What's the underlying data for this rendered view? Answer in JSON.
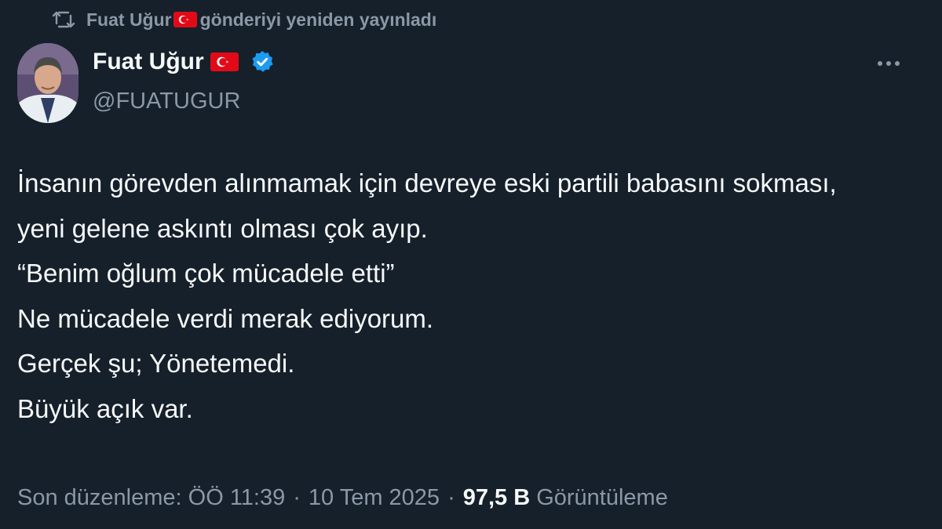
{
  "repost": {
    "name": "Fuat Uğur",
    "flag_icon": "turkey-flag-icon",
    "text": "gönderiyi yeniden yayınladı"
  },
  "author": {
    "display_name": "Fuat Uğur",
    "handle": "@FUATUGUR",
    "verified": true,
    "verified_color": "#1d9bf0"
  },
  "tweet": {
    "lines": [
      "İnsanın görevden alınmamak için devreye eski partili babasını sokması,",
      "yeni gelene askıntı olması çok ayıp.",
      "“Benim oğlum çok mücadele etti”",
      "Ne mücadele verdi merak ediyorum.",
      "Gerçek şu; Yönetemedi.",
      "Büyük açık var."
    ]
  },
  "meta": {
    "edited_label": "Son düzenleme: ÖÖ 11:39",
    "separator": "·",
    "date": "10 Tem 2025",
    "views_count": "97,5 B",
    "views_label": "Görüntüleme"
  },
  "colors": {
    "background": "#15202b",
    "text": "#f7f9f9",
    "secondary": "#8b98a5",
    "flag_red": "#e30a17"
  }
}
